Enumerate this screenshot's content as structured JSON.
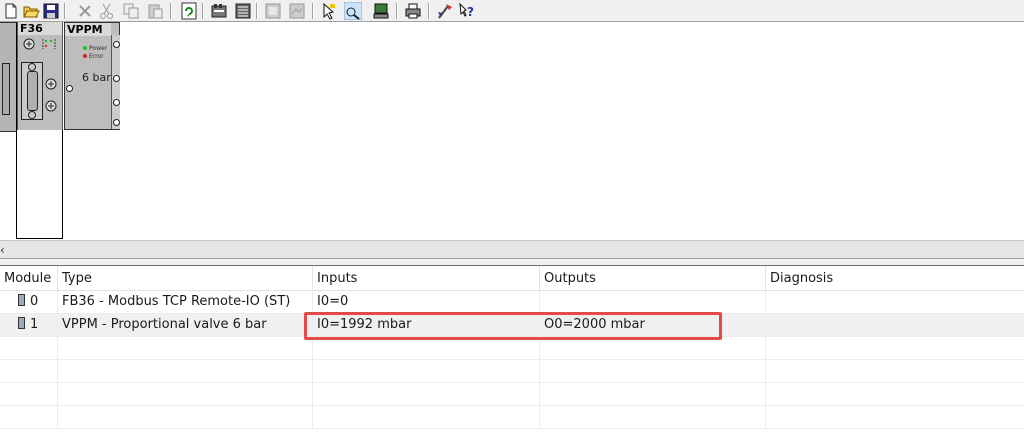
{
  "toolbar": {
    "buttons": [
      {
        "name": "new-icon"
      },
      {
        "name": "open-icon"
      },
      {
        "name": "save-icon"
      },
      {
        "name": "delete-icon"
      },
      {
        "name": "cut-icon"
      },
      {
        "name": "copy-icon"
      },
      {
        "name": "paste-icon"
      },
      {
        "name": "refresh-icon"
      },
      {
        "name": "module-catalog-icon"
      },
      {
        "name": "module-list-icon"
      },
      {
        "name": "view-a-icon"
      },
      {
        "name": "view-b-icon"
      },
      {
        "name": "pointer-icon"
      },
      {
        "name": "online-icon"
      },
      {
        "name": "monitor-icon"
      },
      {
        "name": "print-icon"
      },
      {
        "name": "config-icon"
      },
      {
        "name": "help-icon"
      }
    ]
  },
  "canvas": {
    "modules": [
      {
        "name": "F36",
        "label": "F36"
      },
      {
        "name": "VPPM",
        "label": "VPPM",
        "led_power": "Power",
        "led_error": "Error",
        "rating": "6 bar"
      }
    ],
    "led_power_color": "#22c722",
    "led_error_color": "#e02020"
  },
  "scrollbar": {
    "left_arrow": "‹"
  },
  "table": {
    "columns": [
      "Module",
      "Type",
      "Inputs",
      "Outputs",
      "Diagnosis"
    ],
    "rows": [
      {
        "module": "0",
        "type": "FB36 - Modbus TCP Remote-IO (ST)",
        "inputs": "I0=0",
        "outputs": "",
        "diagnosis": ""
      },
      {
        "module": "1",
        "type": "VPPM - Proportional valve 6 bar",
        "inputs": "I0=1992 mbar",
        "outputs": "O0=2000 mbar",
        "diagnosis": ""
      }
    ]
  },
  "highlight_color": "#e34b4b"
}
